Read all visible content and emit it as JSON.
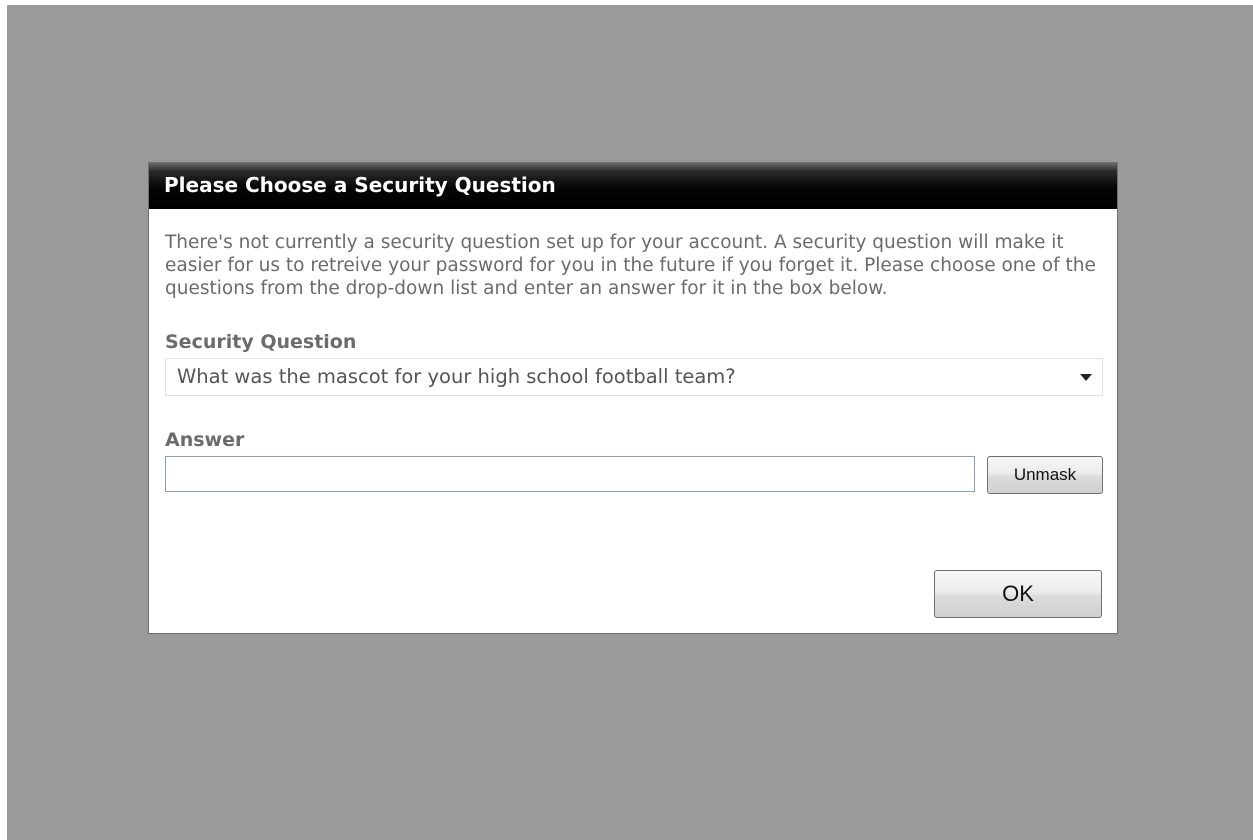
{
  "dialog": {
    "title": "Please Choose a Security Question",
    "message": "There's not currently a security question set up for your account. A security question will make it easier for us to retreive your password for you in the future if you forget it. Please choose one of the questions from the drop-down list and enter an answer for it in the box below.",
    "security_question_label": "Security Question",
    "security_question_selected": "What was the mascot for your high school football team?",
    "answer_label": "Answer",
    "answer_value": "",
    "unmask_label": "Unmask",
    "ok_label": "OK"
  },
  "icons": {
    "select_arrow": "chevron-down-icon"
  },
  "colors": {
    "overlay": "#9a9a9a",
    "header_bg": "#000000",
    "header_text": "#ffffff",
    "body_text": "#6b6b6b"
  }
}
